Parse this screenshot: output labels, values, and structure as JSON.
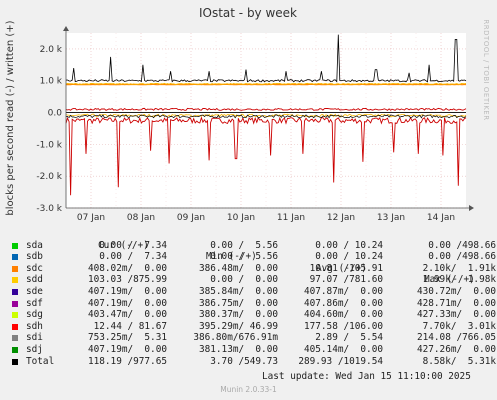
{
  "chart_data": {
    "type": "line",
    "title": "IOstat - by week",
    "ylabel": "blocks per second read (-) / written (+)",
    "side_label": "RRDTOOL / TOBI OETIKER",
    "ylim": [
      -3000,
      2500
    ],
    "yticks": [
      {
        "value": 2000,
        "label": "2.0 k"
      },
      {
        "value": 1000,
        "label": "1.0 k"
      },
      {
        "value": 0,
        "label": "0.0"
      },
      {
        "value": -1000,
        "label": "-1.0 k"
      },
      {
        "value": -2000,
        "label": "-2.0 k"
      },
      {
        "value": -3000,
        "label": "-3.0 k"
      }
    ],
    "xrange_days": [
      0,
      8
    ],
    "xticks": [
      {
        "day": 0.5,
        "label": "07 Jan"
      },
      {
        "day": 1.5,
        "label": "08 Jan"
      },
      {
        "day": 2.5,
        "label": "09 Jan"
      },
      {
        "day": 3.5,
        "label": "10 Jan"
      },
      {
        "day": 4.5,
        "label": "11 Jan"
      },
      {
        "day": 5.5,
        "label": "12 Jan"
      },
      {
        "day": 6.5,
        "label": "13 Jan"
      },
      {
        "day": 7.5,
        "label": "14 Jan"
      }
    ],
    "series": [
      {
        "name": "sdh",
        "color": "#cc0000",
        "write_base": 100,
        "read_base": -250
      },
      {
        "name": "Total",
        "color": "#000000",
        "write_base": 1000,
        "read_base": -120
      },
      {
        "name": "sdd",
        "color": "#f8b800",
        "write_base": 900,
        "read_base": -90
      },
      {
        "name": "sdc",
        "color": "#ff7f00",
        "write_base": 880,
        "read_base": 0
      }
    ],
    "spikes_total_write": [
      {
        "day": 0.15,
        "value": 1400
      },
      {
        "day": 0.9,
        "value": 1750
      },
      {
        "day": 1.55,
        "value": 1500
      },
      {
        "day": 2.1,
        "value": 1300
      },
      {
        "day": 2.85,
        "value": 1300
      },
      {
        "day": 3.6,
        "value": 1350
      },
      {
        "day": 4.4,
        "value": 1300
      },
      {
        "day": 5.1,
        "value": 1300
      },
      {
        "day": 5.45,
        "value": 2450
      },
      {
        "day": 6.2,
        "value": 1350
      },
      {
        "day": 6.85,
        "value": 1250
      },
      {
        "day": 7.25,
        "value": 1500
      },
      {
        "day": 7.8,
        "value": 2300
      }
    ],
    "spikes_sdh_read": [
      {
        "day": 0.1,
        "value": -2600
      },
      {
        "day": 0.4,
        "value": -1300
      },
      {
        "day": 1.05,
        "value": -2350
      },
      {
        "day": 1.7,
        "value": -1200
      },
      {
        "day": 2.05,
        "value": -1600
      },
      {
        "day": 2.85,
        "value": -1500
      },
      {
        "day": 3.4,
        "value": -1450
      },
      {
        "day": 4.1,
        "value": -1350
      },
      {
        "day": 4.75,
        "value": -1300
      },
      {
        "day": 5.35,
        "value": -2200
      },
      {
        "day": 5.95,
        "value": -1550
      },
      {
        "day": 6.55,
        "value": -1250
      },
      {
        "day": 7.05,
        "value": -1300
      },
      {
        "day": 7.55,
        "value": -1350
      },
      {
        "day": 7.85,
        "value": -2300
      }
    ]
  },
  "legend": {
    "header": {
      "cur": "Cur (-/+)",
      "min": "Min (-/+)",
      "avg": "Avg (-/+)",
      "max": "Max (-/+)"
    },
    "rows": [
      {
        "name": "sda",
        "color": "#00cc00",
        "cur": "0.00 /  7.34",
        "min": "0.00 /  5.56",
        "avg": "0.00 / 10.24",
        "max": "0.00 /498.66"
      },
      {
        "name": "sdb",
        "color": "#0066b3",
        "cur": "0.00 /  7.34",
        "min": "0.00 /  5.56",
        "avg": "0.00 / 10.24",
        "max": "0.00 /498.66"
      },
      {
        "name": "sdc",
        "color": "#ff8000",
        "cur": "408.02m/  0.00",
        "min": "386.48m/  0.00",
        "avg": "10.81 /105.91",
        "max": "2.10k/  1.91k"
      },
      {
        "name": "sdd",
        "color": "#ffcc00",
        "cur": "103.03 /875.99",
        "min": "0.00 /  0.00",
        "avg": "97.07 /781.60",
        "max": "1.99k/  1.98k"
      },
      {
        "name": "sde",
        "color": "#330099",
        "cur": "407.19m/  0.00",
        "min": "385.84m/  0.00",
        "avg": "407.87m/  0.00",
        "max": "430.72m/  0.00"
      },
      {
        "name": "sdf",
        "color": "#990099",
        "cur": "407.19m/  0.00",
        "min": "386.75m/  0.00",
        "avg": "407.86m/  0.00",
        "max": "428.71m/  0.00"
      },
      {
        "name": "sdg",
        "color": "#ccff00",
        "cur": "403.47m/  0.00",
        "min": "380.37m/  0.00",
        "avg": "404.60m/  0.00",
        "max": "427.33m/  0.00"
      },
      {
        "name": "sdh",
        "color": "#ff0000",
        "cur": "12.44 / 81.67",
        "min": "395.29m/ 46.99",
        "avg": "177.58 /106.00",
        "max": "7.70k/  3.01k"
      },
      {
        "name": "sdi",
        "color": "#808080",
        "cur": "753.25m/  5.31",
        "min": "386.80m/676.91m",
        "avg": "2.89 /  5.54",
        "max": "214.08 /766.05"
      },
      {
        "name": "sdj",
        "color": "#008f00",
        "cur": "407.19m/  0.00",
        "min": "381.13m/  0.00",
        "avg": "405.14m/  0.00",
        "max": "427.26m/  0.00"
      },
      {
        "name": "Total",
        "color": "#000000",
        "cur": "118.19 /977.65",
        "min": "3.70 /549.73",
        "avg": "289.93 /1019.54",
        "max": "8.58k/  5.31k"
      }
    ]
  },
  "footer": {
    "last_update": "Last update: Wed Jan 15 11:10:00 2025",
    "munin": "Munin 2.0.33-1"
  }
}
